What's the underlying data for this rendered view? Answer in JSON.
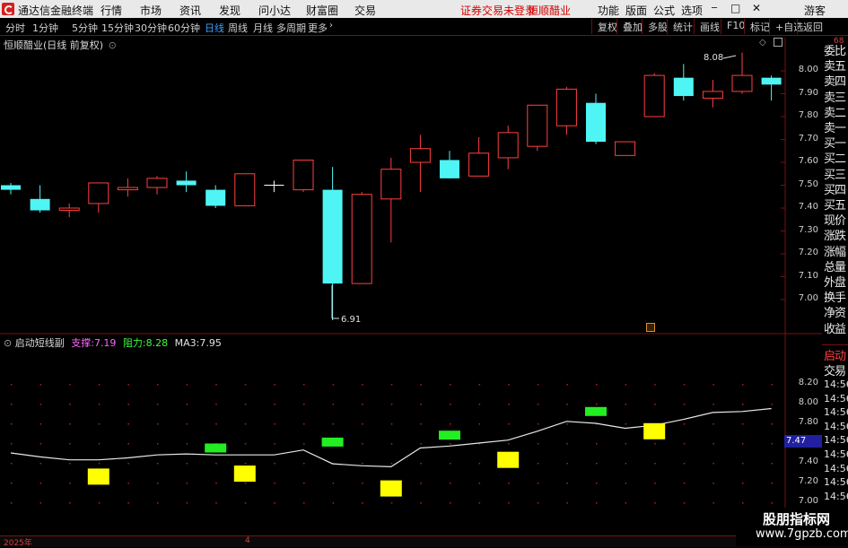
{
  "menubar": {
    "app_title": "通达信金融终端",
    "menus": [
      "行情",
      "市场",
      "资讯",
      "发现",
      "问小达",
      "财富圈",
      "交易"
    ],
    "status_text": "证券交易未登录",
    "stock_name": "恒顺醋业",
    "right_items": [
      "功能",
      "版面",
      "公式",
      "选项"
    ],
    "user": "游客"
  },
  "periodbar": {
    "periods": [
      "分时",
      "1分钟",
      "5分钟",
      "15分钟",
      "30分钟",
      "60分钟",
      "日线",
      "周线",
      "月线",
      "多周期",
      "更多"
    ],
    "active_period": "日线",
    "tools": [
      "复权",
      "叠加",
      "多股",
      "统计",
      "画线",
      "F10",
      "标记",
      "+自选",
      "返回"
    ]
  },
  "main_chart": {
    "title": "恒顺醋业(日线 前复权)",
    "price_ticks": [
      "8.00",
      "7.90",
      "7.80",
      "7.70",
      "7.60",
      "7.50",
      "7.40",
      "7.30",
      "7.20",
      "7.10",
      "7.00"
    ],
    "high_label": "8.08",
    "low_label": "6.91",
    "colors": {
      "up": "#ff4040",
      "down": "#4ff5f5",
      "cross": "#ffffff"
    }
  },
  "chart_data": [
    {
      "type": "candlestick",
      "title": "恒顺醋业(日线 前复权)",
      "ylim": [
        6.9,
        8.1
      ],
      "series": [
        {
          "name": "daily",
          "ohlc": [
            [
              7.5,
              7.51,
              7.46,
              7.48
            ],
            [
              7.44,
              7.5,
              7.38,
              7.39
            ],
            [
              7.39,
              7.42,
              7.36,
              7.4
            ],
            [
              7.42,
              7.51,
              7.38,
              7.51
            ],
            [
              7.48,
              7.53,
              7.45,
              7.49
            ],
            [
              7.49,
              7.54,
              7.46,
              7.53
            ],
            [
              7.52,
              7.56,
              7.47,
              7.5
            ],
            [
              7.48,
              7.5,
              7.4,
              7.41
            ],
            [
              7.41,
              7.55,
              7.41,
              7.55
            ],
            [
              7.5,
              7.52,
              7.47,
              7.5
            ],
            [
              7.48,
              7.61,
              7.47,
              7.61
            ],
            [
              7.48,
              7.58,
              6.91,
              7.07
            ],
            [
              7.07,
              7.47,
              7.07,
              7.46
            ],
            [
              7.44,
              7.62,
              7.25,
              7.57
            ],
            [
              7.6,
              7.72,
              7.47,
              7.66
            ],
            [
              7.61,
              7.65,
              7.53,
              7.53
            ],
            [
              7.54,
              7.71,
              7.54,
              7.64
            ],
            [
              7.62,
              7.76,
              7.57,
              7.73
            ],
            [
              7.67,
              7.84,
              7.65,
              7.85
            ],
            [
              7.76,
              7.93,
              7.72,
              7.92
            ],
            [
              7.86,
              7.9,
              7.68,
              7.69
            ],
            [
              7.63,
              7.69,
              7.63,
              7.69
            ],
            [
              7.8,
              7.99,
              7.8,
              7.98
            ],
            [
              7.97,
              8.03,
              7.87,
              7.89
            ],
            [
              7.88,
              7.96,
              7.84,
              7.91
            ],
            [
              7.91,
              8.08,
              7.9,
              7.98
            ],
            [
              7.97,
              7.98,
              7.87,
              7.94
            ]
          ]
        }
      ]
    },
    {
      "type": "line",
      "title": "启动短线副",
      "ylim": [
        7.0,
        8.3
      ],
      "series": [
        {
          "name": "MA3",
          "values": [
            7.5,
            7.46,
            7.43,
            7.43,
            7.45,
            7.48,
            7.49,
            7.48,
            7.48,
            7.48,
            7.53,
            7.39,
            7.37,
            7.36,
            7.55,
            7.57,
            7.6,
            7.63,
            7.72,
            7.82,
            7.8,
            7.75,
            7.78,
            7.84,
            7.91,
            7.92,
            7.95
          ]
        },
        {
          "name": "支撑",
          "markers": [
            [
              3,
              7.26
            ],
            [
              8,
              7.29
            ],
            [
              13,
              7.14
            ],
            [
              17,
              7.43
            ],
            [
              22,
              7.72
            ]
          ]
        },
        {
          "name": "阻力",
          "markers": [
            [
              7,
              7.55
            ],
            [
              11,
              7.61
            ],
            [
              15,
              7.68
            ],
            [
              20,
              7.92
            ]
          ]
        }
      ],
      "y_ticks": [
        "8.20",
        "8.00",
        "7.80",
        "7.60",
        "7.40",
        "7.20",
        "7.00"
      ],
      "current_value": "7.47"
    }
  ],
  "indicator": {
    "name": "启动短线副",
    "support_label": "支撑:",
    "support_value": "7.19",
    "resistance_label": "阻力:",
    "resistance_value": "8.28",
    "ma_label": "MA3:",
    "ma_value": "7.95",
    "current_tag": "7.47"
  },
  "right_panel": {
    "top_lbl": "68",
    "items": [
      "委比",
      "卖五",
      "卖四",
      "卖三",
      "卖二",
      "卖一",
      "买一",
      "买二",
      "买三",
      "买四",
      "买五",
      "现价",
      "涨跌",
      "涨幅",
      "总量",
      "外盘",
      "换手",
      "净资",
      "收益"
    ],
    "section2_title": "启动",
    "section2_sub": "交易",
    "times": [
      "14:56",
      "14:56",
      "14:56",
      "14:56",
      "14:56",
      "14:56",
      "14:56",
      "14:56",
      "14:56"
    ]
  },
  "bottombar": {
    "date_label": "2025年",
    "month_label": "4"
  },
  "watermark": {
    "line1": "股朋指标网",
    "line2": "www.7gpzb.com"
  }
}
